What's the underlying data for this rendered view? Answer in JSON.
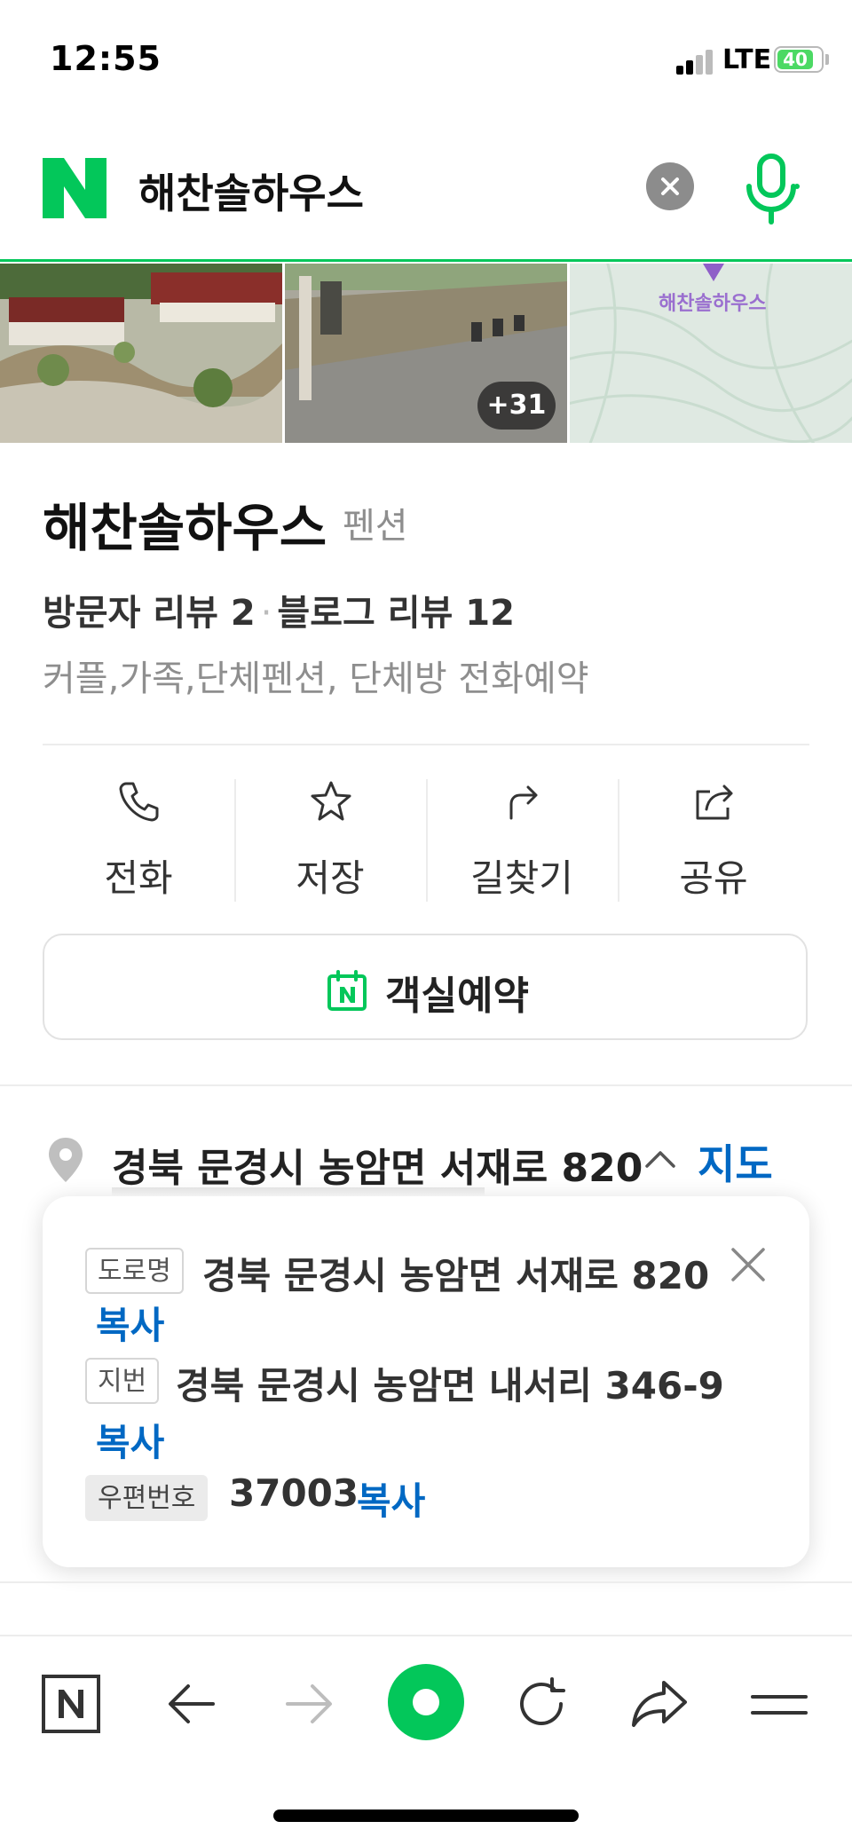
{
  "status_bar": {
    "time": "12:55",
    "network": "LTE",
    "battery": "40"
  },
  "search": {
    "query": "해찬솔하우스"
  },
  "photos": {
    "more_count": "+31",
    "map_label": "해찬솔하우스"
  },
  "place": {
    "name": "해찬솔하우스",
    "category": "펜션",
    "visitor_reviews": "방문자 리뷰 2",
    "separator": "·",
    "blog_reviews": "블로그 리뷰 12",
    "description": "커플,가족,단체펜션, 단체방 전화예약"
  },
  "actions": [
    {
      "label": "전화",
      "icon": "phone-icon"
    },
    {
      "label": "저장",
      "icon": "star-icon"
    },
    {
      "label": "길찾기",
      "icon": "directions-icon"
    },
    {
      "label": "공유",
      "icon": "share-icon"
    }
  ],
  "reservation": {
    "label": "객실예약"
  },
  "address": {
    "main": "경북 문경시 농암면 서재로 820",
    "map_link": "지도",
    "road_tag": "도로명",
    "road_address": "경북 문경시 농암면 서재로 820",
    "lot_tag": "지번",
    "lot_address": "경북 문경시 농암면 내서리 346-9",
    "postal_tag": "우편번호",
    "postal_code": "37003",
    "copy_label": "복사"
  },
  "colors": {
    "naver_green": "#03c75a",
    "link_blue": "#0068c3"
  }
}
